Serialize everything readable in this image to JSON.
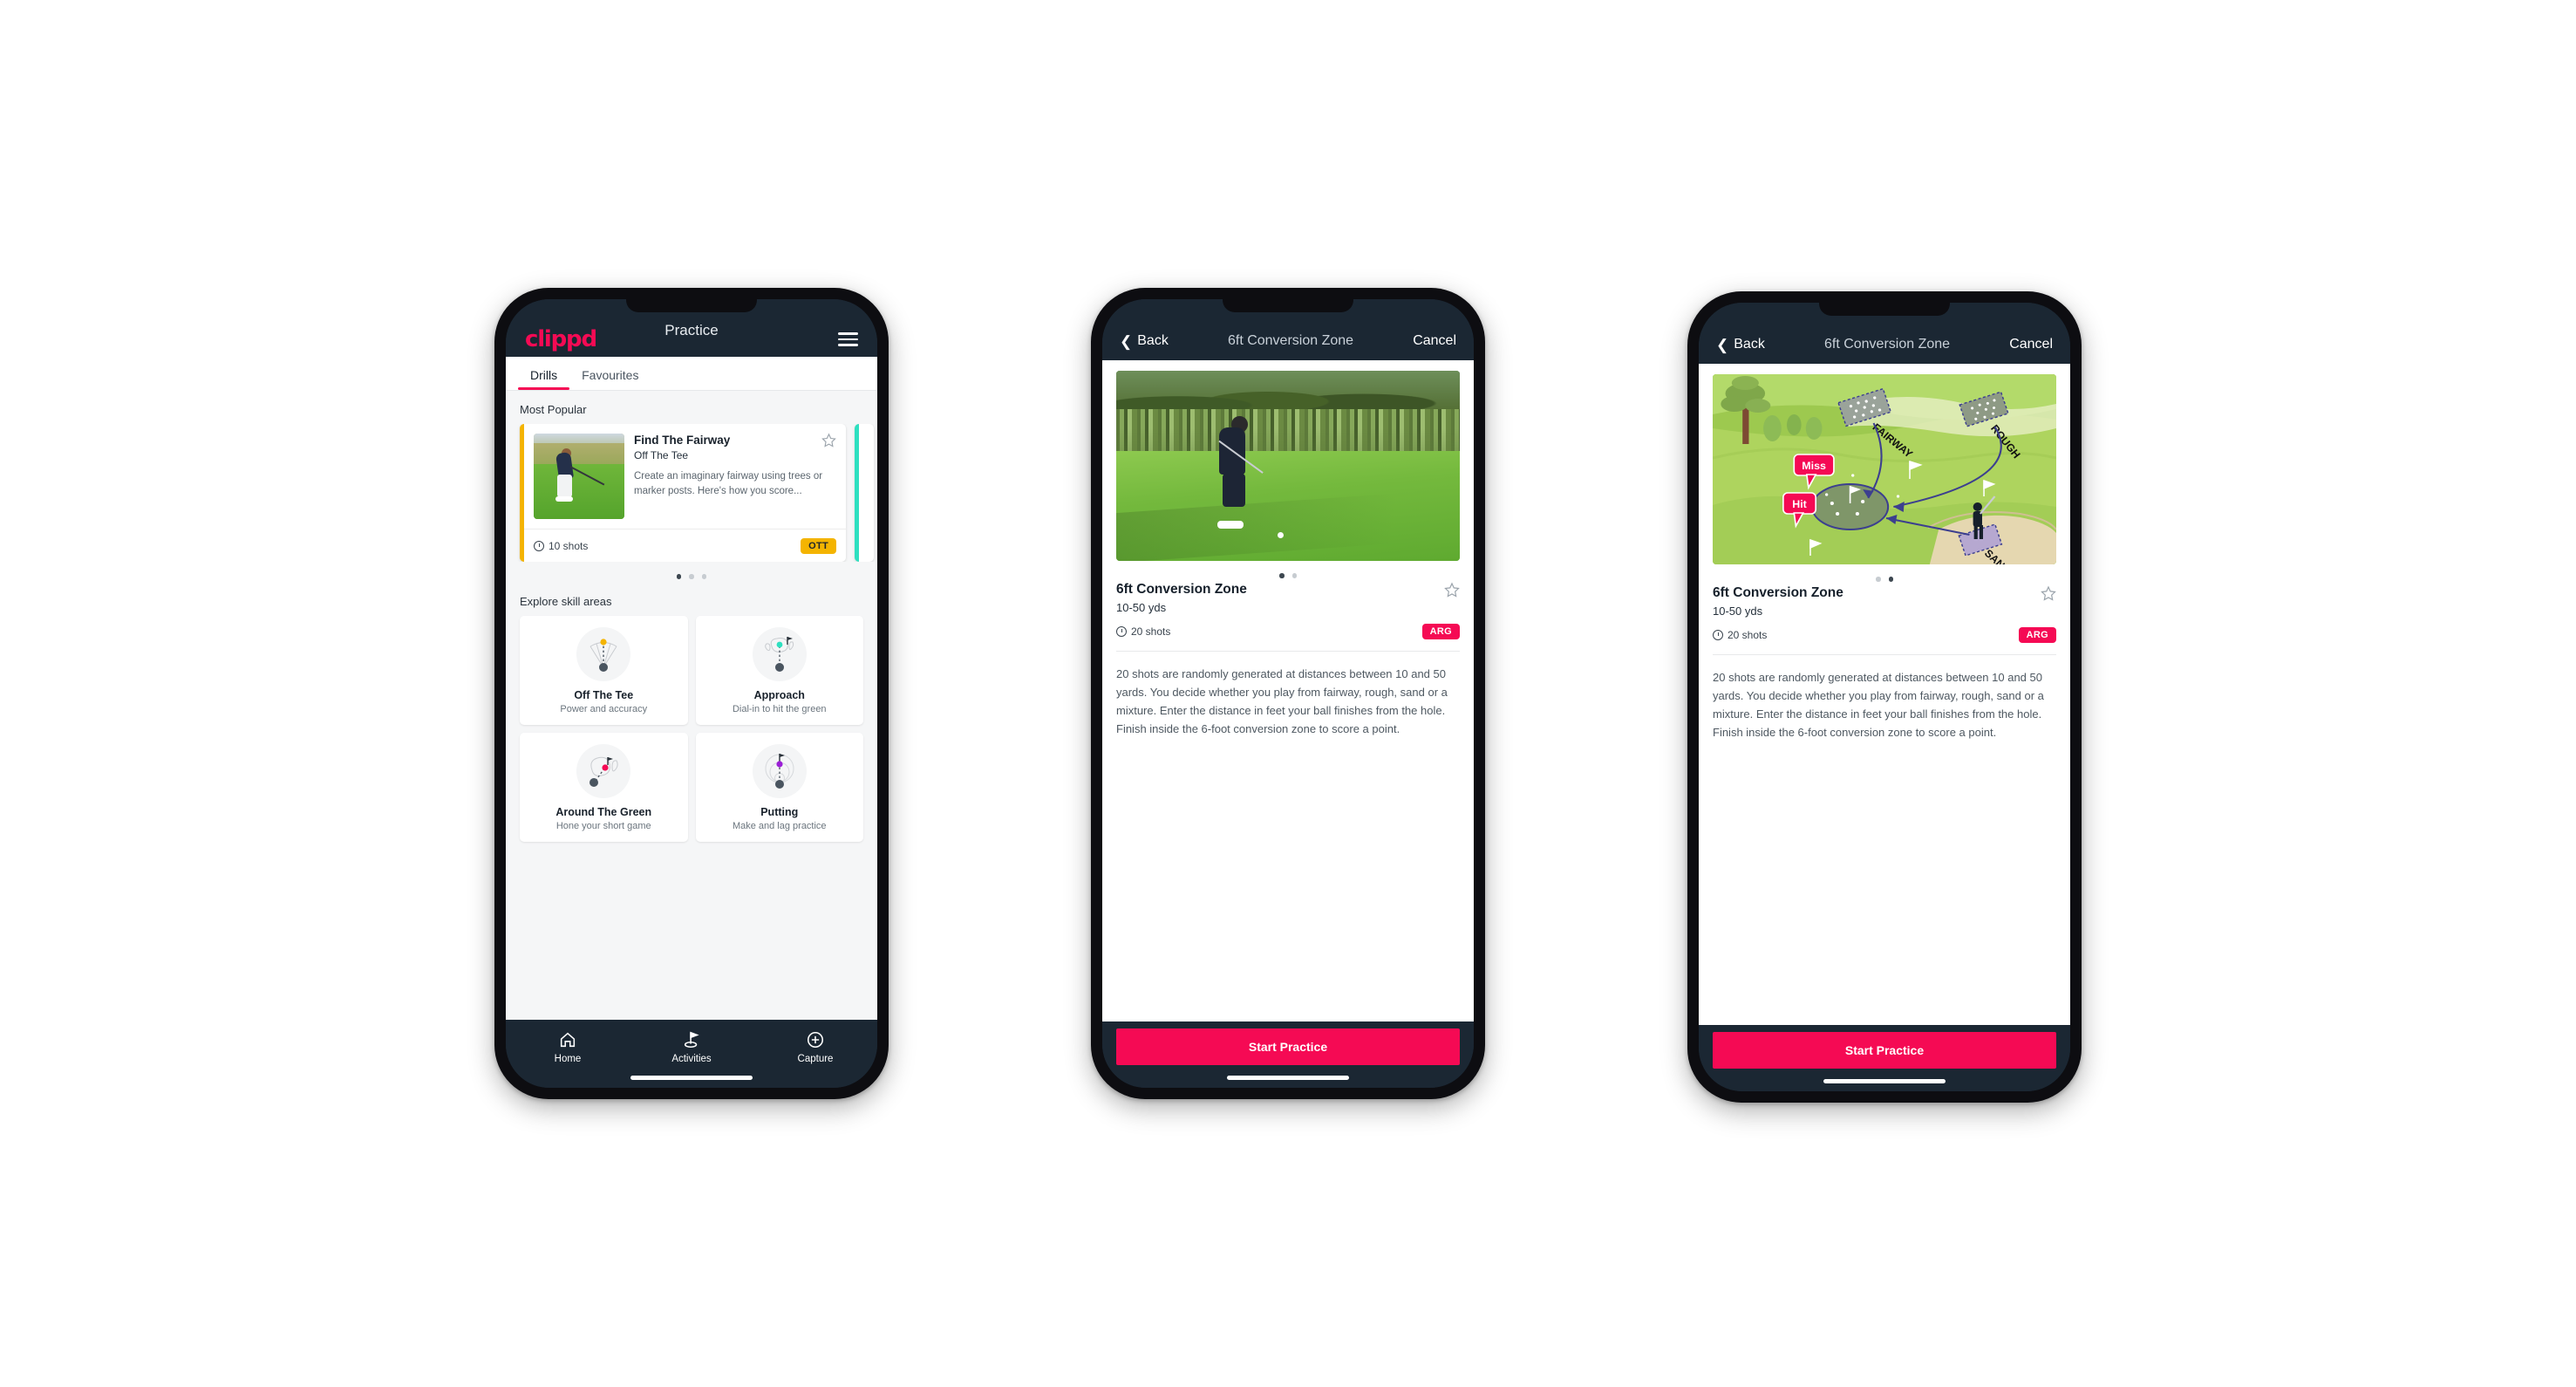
{
  "brand": {
    "name": "clippd",
    "accent": "#f50a54",
    "dark": "#1b2733"
  },
  "phone1": {
    "appbar": {
      "logo": "clippd",
      "title": "Practice",
      "menu_icon": "hamburger-icon"
    },
    "tabs": [
      {
        "label": "Drills",
        "active": true
      },
      {
        "label": "Favourites",
        "active": false
      }
    ],
    "most_popular": {
      "section_label": "Most Popular",
      "card": {
        "title": "Find The Fairway",
        "subtitle": "Off The Tee",
        "description": "Create an imaginary fairway using trees or marker posts. Here's how you score...",
        "shots": "10 shots",
        "badge": "OTT",
        "badge_color": "#f4b400",
        "accent_bar": "#f4b400",
        "next_accent_bar": "#2ee0c0",
        "favourite_icon": "star-outline-icon"
      },
      "pagination": {
        "count": 3,
        "active_index": 0
      }
    },
    "explore": {
      "section_label": "Explore skill areas",
      "cards": [
        {
          "name": "Off The Tee",
          "desc": "Power and accuracy",
          "icon": "dispersion-fan-icon",
          "dot_color": "#f4b400"
        },
        {
          "name": "Approach",
          "desc": "Dial-in to hit the green",
          "icon": "green-target-icon",
          "dot_color": "#2ee0c0"
        },
        {
          "name": "Around The Green",
          "desc": "Hone your short game",
          "icon": "chip-to-green-icon",
          "dot_color": "#f50a54"
        },
        {
          "name": "Putting",
          "desc": "Make and lag practice",
          "icon": "putting-rings-icon",
          "dot_color": "#9b1fd6"
        }
      ]
    },
    "bottomnav": [
      {
        "label": "Home",
        "icon": "home-icon",
        "active": false
      },
      {
        "label": "Activities",
        "icon": "golf-flag-icon",
        "active": true
      },
      {
        "label": "Capture",
        "icon": "plus-circle-icon",
        "active": false
      }
    ]
  },
  "phone2": {
    "navbar": {
      "back": "Back",
      "title": "6ft Conversion Zone",
      "cancel": "Cancel",
      "back_icon": "chevron-left-icon"
    },
    "hero": {
      "type": "photo",
      "alt": "golfer-chipping-photo"
    },
    "pagination": {
      "count": 2,
      "active_index": 0
    },
    "detail": {
      "title": "6ft Conversion Zone",
      "subtitle": "10-50 yds",
      "shots": "20 shots",
      "badge": "ARG",
      "badge_color": "#f50a54",
      "favourite_icon": "star-outline-icon",
      "description": "20 shots are randomly generated at distances between 10 and 50 yards. You decide whether you play from fairway, rough, sand or a mixture. Enter the distance in feet your ball finishes from the hole. Finish inside the 6-foot conversion zone to score a point."
    },
    "cta": "Start Practice"
  },
  "phone3": {
    "navbar": {
      "back": "Back",
      "title": "6ft Conversion Zone",
      "cancel": "Cancel",
      "back_icon": "chevron-left-icon"
    },
    "hero": {
      "type": "illustration",
      "alt": "golf-course-diagram",
      "labels": [
        "FAIRWAY",
        "ROUGH",
        "SAND"
      ],
      "markers": [
        "Miss",
        "Hit"
      ],
      "marker_color": "#f50a54"
    },
    "pagination": {
      "count": 2,
      "active_index": 1
    },
    "detail": {
      "title": "6ft Conversion Zone",
      "subtitle": "10-50 yds",
      "shots": "20 shots",
      "badge": "ARG",
      "badge_color": "#f50a54",
      "favourite_icon": "star-outline-icon",
      "description": "20 shots are randomly generated at distances between 10 and 50 yards. You decide whether you play from fairway, rough, sand or a mixture. Enter the distance in feet your ball finishes from the hole. Finish inside the 6-foot conversion zone to score a point."
    },
    "cta": "Start Practice"
  }
}
